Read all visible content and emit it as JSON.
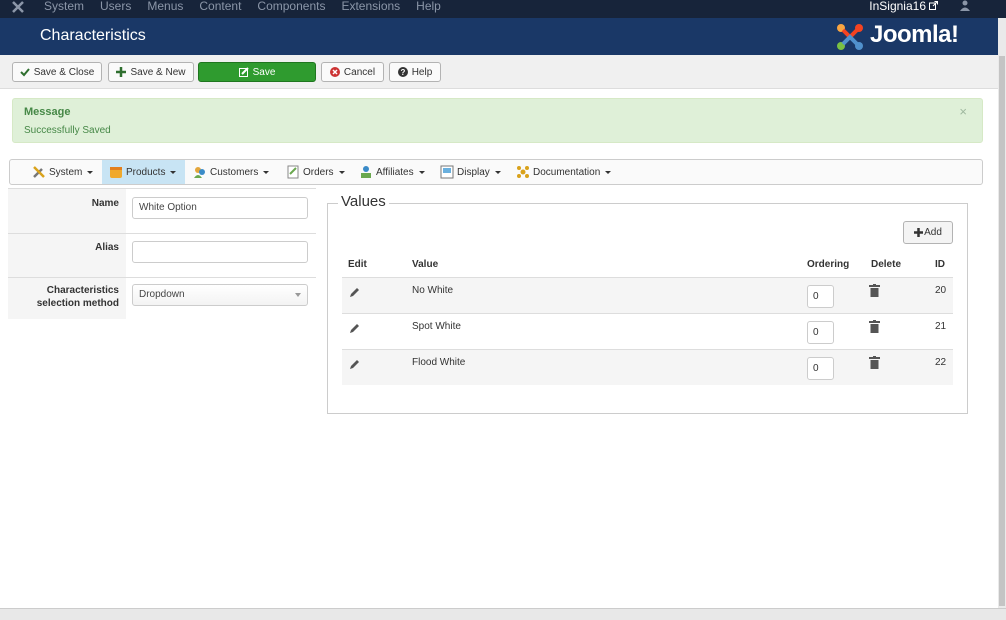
{
  "topnav": {
    "menu": [
      "System",
      "Users",
      "Menus",
      "Content",
      "Components",
      "Extensions",
      "Help"
    ],
    "site_name": "InSignia16",
    "icons": [
      "joomla-icon",
      "external-link-icon",
      "user-icon"
    ]
  },
  "header": {
    "title": "Characteristics",
    "brand": "Joomla!"
  },
  "toolbar": {
    "save_close": "Save & Close",
    "save_new": "Save & New",
    "save": "Save",
    "cancel": "Cancel",
    "help": "Help"
  },
  "message": {
    "title": "Message",
    "text": "Successfully Saved",
    "close": "×"
  },
  "component_menu": {
    "items": [
      {
        "label": "System",
        "icon": "tools-icon"
      },
      {
        "label": "Products",
        "icon": "products-icon",
        "active": true
      },
      {
        "label": "Customers",
        "icon": "customers-icon"
      },
      {
        "label": "Orders",
        "icon": "orders-icon"
      },
      {
        "label": "Affiliates",
        "icon": "affiliates-icon"
      },
      {
        "label": "Display",
        "icon": "display-icon"
      },
      {
        "label": "Documentation",
        "icon": "documentation-icon"
      }
    ]
  },
  "form": {
    "name_label": "Name",
    "name_value": "White Option",
    "alias_label": "Alias",
    "alias_value": "",
    "method_label": "Characteristics selection method",
    "method_value": "Dropdown"
  },
  "values": {
    "legend": "Values",
    "add_label": "Add",
    "headers": {
      "edit": "Edit",
      "value": "Value",
      "ordering": "Ordering",
      "delete": "Delete",
      "id": "ID"
    },
    "rows": [
      {
        "value": "No White",
        "ordering": "0",
        "id": "20"
      },
      {
        "value": "Spot White",
        "ordering": "0",
        "id": "21"
      },
      {
        "value": "Flood White",
        "ordering": "0",
        "id": "22"
      }
    ]
  },
  "colors": {
    "topnav_bg": "#17243a",
    "header_bg": "#1a3867",
    "save_green": "#2f9b2f",
    "success_bg": "#dff0d8",
    "success_text": "#468847",
    "active_menu": "#c8e4f4"
  }
}
